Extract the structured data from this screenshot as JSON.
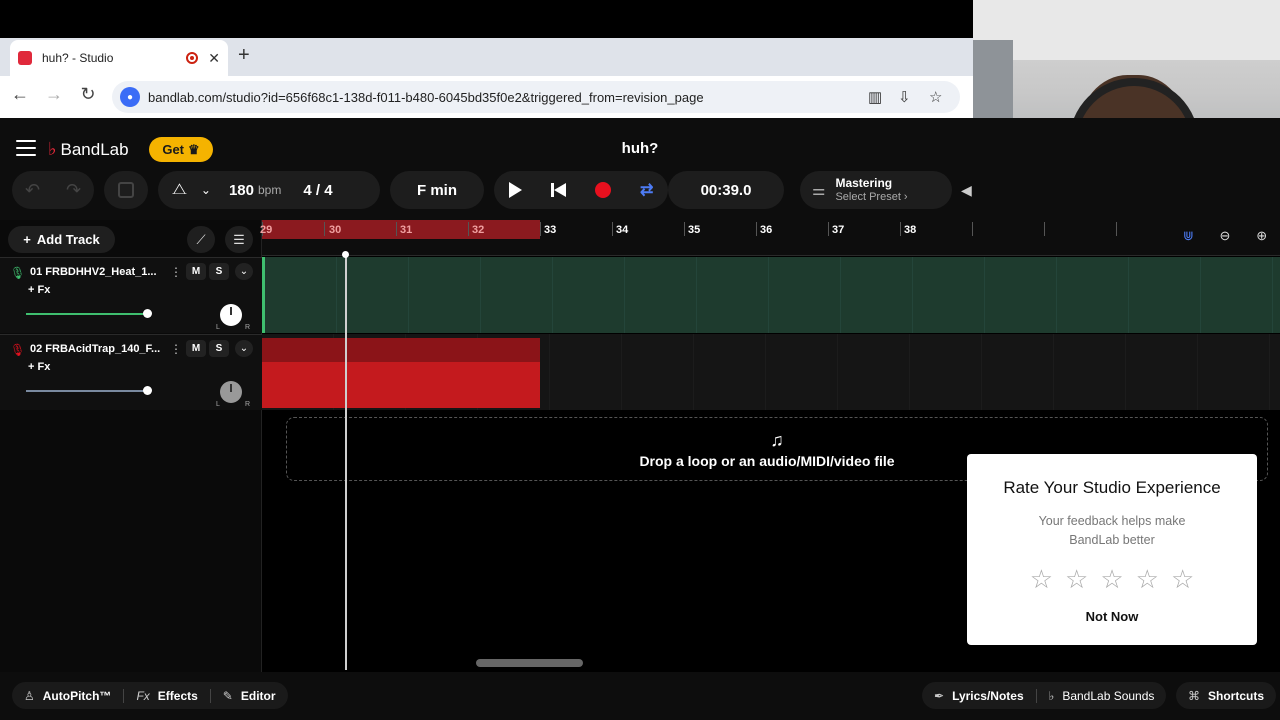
{
  "browser": {
    "tab_title": "huh? - Studio",
    "tab_close": "✕",
    "new_tab": "+",
    "url": "bandlab.com/studio?id=656f68c1-138d-f011-b480-6045bd35f0e2&triggered_from=revision_page",
    "back": "←",
    "forward": "→",
    "reload": "↻"
  },
  "header": {
    "brand": "BandLab",
    "get_label": "Get",
    "project_title": "huh?"
  },
  "toolbar": {
    "tempo_value": "180",
    "tempo_unit": "bpm",
    "time_signature": "4 / 4",
    "key": "F min",
    "time": "00:39.0",
    "mastering_title": "Mastering",
    "mastering_preset": "Select Preset ›"
  },
  "tracks_panel": {
    "add_track_label": "Add Track"
  },
  "tracks": [
    {
      "name": "01  FRBDHHV2_Heat_1...",
      "mute": "M",
      "solo": "S",
      "fx": "+ Fx",
      "volume": 0.99,
      "color": "#3fbf6f"
    },
    {
      "name": "02  FRBAcidTrap_140_F...",
      "mute": "M",
      "solo": "S",
      "fx": "+ Fx",
      "volume": 0.99,
      "color": "#e8101e"
    }
  ],
  "ruler": {
    "bars": [
      "29",
      "30",
      "31",
      "32",
      "33",
      "34",
      "35",
      "36",
      "37",
      "38"
    ]
  },
  "drop_zone": {
    "text": "Drop a loop or an audio/MIDI/video file"
  },
  "rating_popup": {
    "title": "Rate Your Studio Experience",
    "subtitle": "Your feedback helps make BandLab better",
    "stars": [
      "☆",
      "☆",
      "☆",
      "☆",
      "☆"
    ],
    "dismiss": "Not Now"
  },
  "bottom_bar": {
    "autopitch": "AutoPitch™",
    "effects": "Effects",
    "editor": "Editor",
    "lyrics": "Lyrics/Notes",
    "sounds": "BandLab Sounds",
    "shortcuts": "Shortcuts"
  },
  "colors": {
    "accent_red": "#e8101e",
    "get_yellow": "#f5b300",
    "loop_blue": "#4d7cf5",
    "track1_green": "#1e3b2e"
  }
}
